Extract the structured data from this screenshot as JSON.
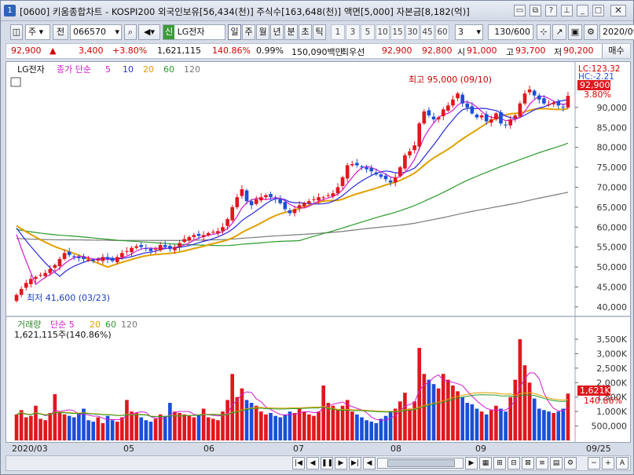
{
  "window": {
    "number": "1",
    "title": "[0600] 키움종합차트 - KOSPI200 외국인보유[56,434(천)] 주식수[163,648(천)] 액면[5,000] 자본금[8,182(억)]"
  },
  "toolbar": {
    "type_label": "주",
    "prev_label": "전",
    "code_value": "066570",
    "credit_badge": "신",
    "stock_name": "LG전자",
    "periods": [
      "일",
      "주",
      "월",
      "년",
      "분",
      "초",
      "틱"
    ],
    "selected_period": "일",
    "intervals": [
      "1",
      "3",
      "5",
      "10",
      "15",
      "30",
      "45",
      "60"
    ],
    "interval_value": "3",
    "count_value": "130/600",
    "date_value": "2020/09"
  },
  "quote": {
    "price": "92,900",
    "arrow": "▲",
    "change": "3,400",
    "change_pct": "+3.80%",
    "volume": "1,621,115",
    "volume_ratio": "140.86%",
    "turnover": "0.99%",
    "amount": "150,090백만",
    "best_ask_label": "최우선",
    "best_ask": "92,900",
    "best_bid": "92,800",
    "open_label": "시",
    "open": "91,000",
    "high_label": "고",
    "high": "93,700",
    "low_label": "저",
    "low": "90,200",
    "order_button": "매수"
  },
  "chart": {
    "legend_name": "LG전자",
    "legend_items": [
      "종가 단순",
      "5",
      "10",
      "20",
      "60",
      "120"
    ],
    "legend_colors": [
      "#d01bd0",
      "#d01bd0",
      "#2a2adb",
      "#e0a000",
      "#2a9a2a",
      "#777777"
    ],
    "hi_annotation": "최고 95,000 (09/10)",
    "lo_annotation": "최저 41,600 (03/23)",
    "lc_label": "LC:123.32",
    "hc_label": "HC:-2.21",
    "current_price_tag": "92,900",
    "current_pct_tag": "3.80%",
    "vol_legend": [
      "거래량",
      "단순",
      "5",
      "20",
      "60",
      "120"
    ],
    "vol_sub": "1,621,115주(140.86%)",
    "vol_tag": "1,621K",
    "vol_pct_tag": "140.86%",
    "date_labels": [
      "2020/03",
      "05",
      "06",
      "07",
      "08",
      "09",
      "09/25"
    ]
  },
  "chart_data": {
    "type": "candlestick",
    "price_axis": {
      "ticks": [
        40000,
        45000,
        50000,
        55000,
        60000,
        65000,
        70000,
        75000,
        80000,
        85000,
        90000
      ],
      "tick_labels": [
        "40,000",
        "45,000",
        "50,000",
        "55,000",
        "60,000",
        "65,000",
        "70,000",
        "75,000",
        "80,000",
        "85,000",
        "90,000"
      ],
      "range": [
        38000,
        101000
      ]
    },
    "volume_axis": {
      "ticks": [
        500000,
        1000000,
        1500000,
        2000000,
        2500000,
        3000000,
        3500000
      ],
      "tick_labels": [
        "500,000",
        "1,000K",
        "1,500K",
        "2,000K",
        "2,500K",
        "3,000K",
        "3,500K"
      ],
      "range": [
        0,
        3800000
      ]
    },
    "closes": [
      43000,
      44500,
      46000,
      47000,
      47500,
      48000,
      48500,
      49500,
      50500,
      52000,
      53500,
      53000,
      52500,
      52200,
      52000,
      51800,
      51500,
      51800,
      52500,
      52000,
      51500,
      52500,
      53500,
      54000,
      54800,
      55200,
      55000,
      54600,
      54000,
      54500,
      55500,
      55000,
      54500,
      55000,
      56000,
      57000,
      57500,
      58000,
      57800,
      58000,
      58500,
      58800,
      59000,
      60000,
      62000,
      65000,
      67500,
      69500,
      66500,
      65500,
      67000,
      67500,
      68000,
      67500,
      67000,
      66000,
      64500,
      63500,
      64500,
      65500,
      66000,
      66500,
      67000,
      67500,
      67500,
      68000,
      68500,
      70000,
      72500,
      75500,
      75800,
      75500,
      75000,
      74500,
      74000,
      73200,
      72600,
      72000,
      71200,
      72500,
      75000,
      78000,
      79000,
      80500,
      86000,
      89000,
      88000,
      87000,
      87500,
      89500,
      90500,
      92000,
      93500,
      91000,
      90000,
      88500,
      87500,
      88000,
      86500,
      87000,
      88500,
      86000,
      85500,
      87000,
      88000,
      91000,
      93500,
      94500,
      93000,
      92000,
      91000,
      90800,
      91200,
      90500,
      90000,
      92900
    ],
    "volumes": [
      900000,
      1050000,
      800000,
      850000,
      1200000,
      750000,
      700000,
      950000,
      1600000,
      1000000,
      900000,
      850000,
      800000,
      950000,
      1100000,
      700000,
      650000,
      800000,
      600000,
      850000,
      700000,
      650000,
      800000,
      1400000,
      1000000,
      950000,
      800000,
      700000,
      650000,
      750000,
      900000,
      850000,
      1300000,
      1000000,
      950000,
      900000,
      850000,
      800000,
      900000,
      1100000,
      800000,
      750000,
      700000,
      1000000,
      1400000,
      2300000,
      1500000,
      1800000,
      1400000,
      1300000,
      1200000,
      1000000,
      900000,
      950000,
      850000,
      800000,
      900000,
      1000000,
      950000,
      1100000,
      1000000,
      900000,
      850000,
      1000000,
      1900000,
      1300000,
      1200000,
      1050000,
      1200000,
      1400000,
      1000000,
      900000,
      800000,
      700000,
      650000,
      600000,
      750000,
      850000,
      1000000,
      1100000,
      1350000,
      1650000,
      1100000,
      1350000,
      3200000,
      2300000,
      2100000,
      1950000,
      1800000,
      2300000,
      2100000,
      1900000,
      1700000,
      1500000,
      1300000,
      1250000,
      1100000,
      1000000,
      900000,
      1050000,
      1200000,
      1100000,
      1000000,
      1500000,
      2100000,
      3500000,
      2600000,
      2000000,
      1450000,
      1100000,
      1050000,
      1000000,
      950000,
      1000000,
      1100000,
      1621115
    ],
    "annotations": {
      "high": {
        "value": 95000,
        "date": "09/10"
      },
      "low": {
        "value": 41600,
        "date": "03/23"
      }
    },
    "legend": "top-left",
    "grid": false
  }
}
